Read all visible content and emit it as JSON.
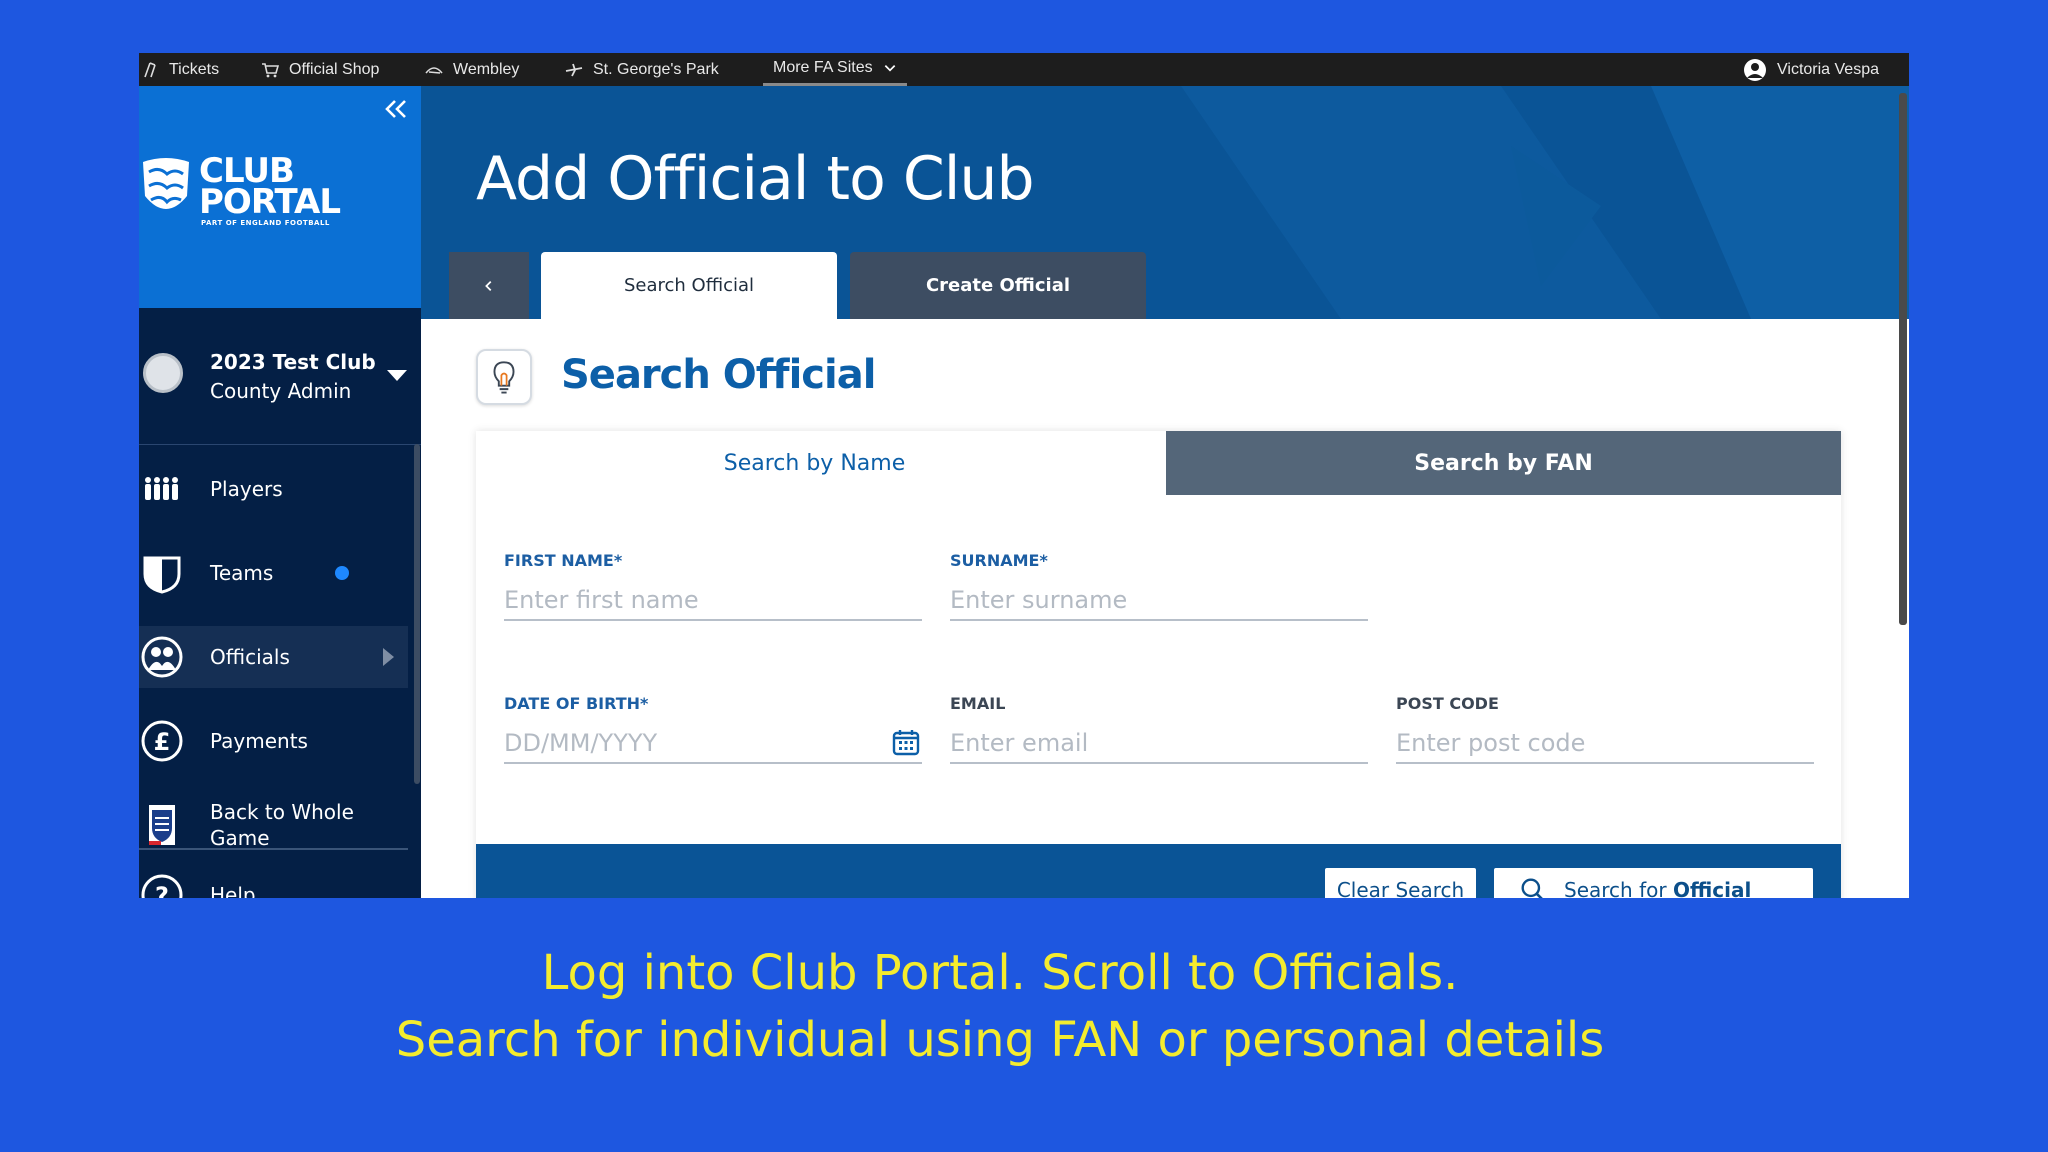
{
  "topbar": {
    "tickets": "Tickets",
    "shop": "Official Shop",
    "wembley": "Wembley",
    "stgeorges": "St. George's Park",
    "more": "More FA Sites",
    "user": "Victoria Vespa"
  },
  "sidebar": {
    "logo": {
      "line1": "CLUB",
      "line2": "PORTAL",
      "tagline": "PART OF ENGLAND FOOTBALL"
    },
    "club": {
      "name": "2023 Test Club",
      "role": "County Admin"
    },
    "items": [
      {
        "label": "Players",
        "icon": "players-icon"
      },
      {
        "label": "Teams",
        "icon": "shield-icon",
        "badge_color": "#1e88ff"
      },
      {
        "label": "Officials",
        "icon": "officials-icon"
      },
      {
        "label": "Payments",
        "icon": "pound-icon"
      },
      {
        "label": "Back to Whole Game",
        "icon": "fa-crest-icon"
      },
      {
        "label": "Help",
        "icon": "help-icon"
      }
    ]
  },
  "header": {
    "title": "Add Official to Club",
    "tabs": [
      {
        "label": "Search Official"
      },
      {
        "label": "Create Official"
      }
    ]
  },
  "main": {
    "section_title": "Search Official",
    "subtabs": [
      {
        "label": "Search by Name"
      },
      {
        "label": "Search by FAN"
      }
    ],
    "fields": {
      "first_name": {
        "label": "FIRST NAME*",
        "placeholder": "Enter first name"
      },
      "surname": {
        "label": "SURNAME*",
        "placeholder": "Enter surname"
      },
      "dob": {
        "label": "DATE OF BIRTH*",
        "placeholder": "DD/MM/YYYY"
      },
      "email": {
        "label": "EMAIL",
        "placeholder": "Enter email"
      },
      "postcode": {
        "label": "POST CODE",
        "placeholder": "Enter post code"
      }
    },
    "buttons": {
      "clear": "Clear Search",
      "search_prefix": "Search for ",
      "search_bold": "Official"
    }
  },
  "caption": {
    "line1": "Log into Club Portal. Scroll to Officials.",
    "line2": "Search for individual using FAN or personal details"
  },
  "colors": {
    "background": "#1e57e0",
    "sidebar": "#041f45",
    "brand": "#0b70d4",
    "header": "#0a5496",
    "caption": "#f4ec2e",
    "accent_text": "#0c5fa8"
  }
}
